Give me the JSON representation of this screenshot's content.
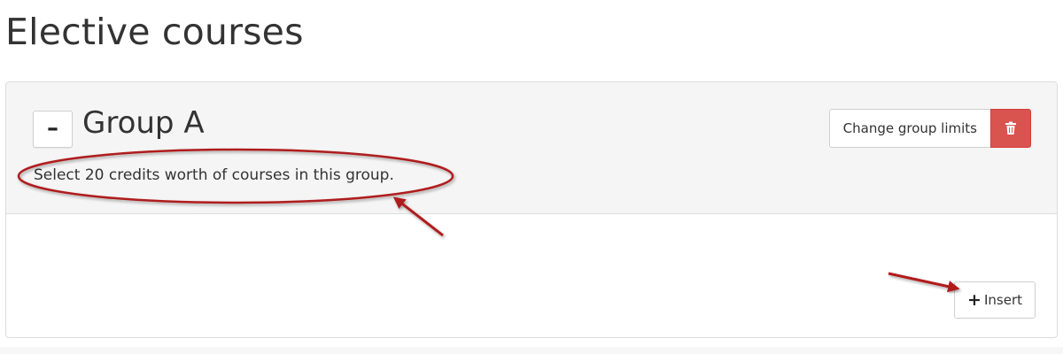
{
  "page": {
    "title": "Elective courses"
  },
  "group": {
    "collapse_label": "–",
    "title": "Group A",
    "description": "Select 20 credits worth of courses in this group.",
    "change_limits_label": "Change group limits",
    "delete_icon": "trash-icon",
    "insert_label": "Insert",
    "insert_icon": "plus-icon"
  },
  "colors": {
    "delete_button": "#d9534f",
    "annotation": "#b01c1c",
    "heading_background": "#f5f5f5"
  }
}
